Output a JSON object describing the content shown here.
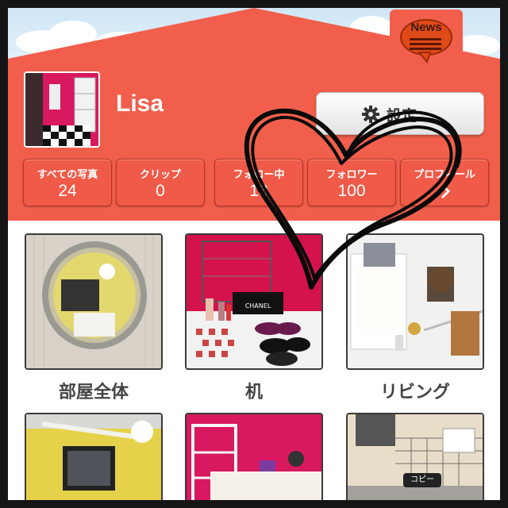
{
  "header": {
    "news_label": "News",
    "username": "Lisa",
    "settings_label": "設定"
  },
  "stats": [
    {
      "label": "すべての写真",
      "value": "24"
    },
    {
      "label": "クリップ",
      "value": "0"
    },
    {
      "label": "フォロー中",
      "value": "13"
    },
    {
      "label": "フォロワー",
      "value": "100"
    },
    {
      "label": "プロフィール",
      "value": ""
    }
  ],
  "rooms": [
    {
      "label": "部屋全体"
    },
    {
      "label": "机"
    },
    {
      "label": "リビング"
    }
  ],
  "photo_text": {
    "chanel": "CHANEL",
    "copy": "コピー"
  },
  "colors": {
    "header": "#f15f4c",
    "stat_button": "#f05a48",
    "label_text": "#444444"
  },
  "icons": [
    "news-speech-bubble-icon",
    "gear-icon",
    "chevron-right-icon",
    "heart-doodle"
  ]
}
